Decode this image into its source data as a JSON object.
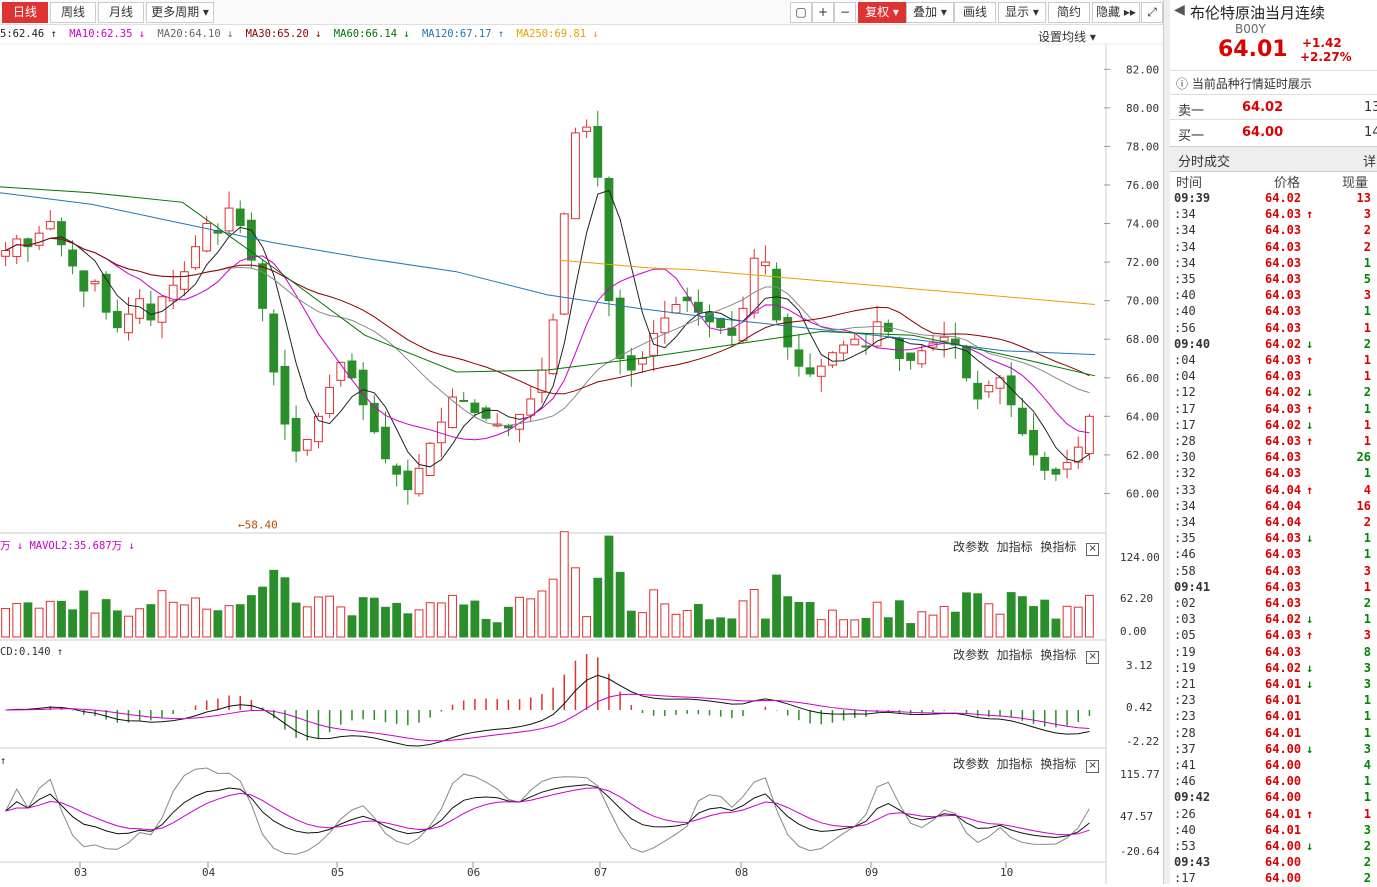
{
  "toolbar": {
    "periods": [
      "日线",
      "周线",
      "月线",
      "更多周期 ▾"
    ],
    "actions": [
      "复权 ▾",
      "叠加 ▾",
      "画线",
      "显示 ▾",
      "简约",
      "隐藏 ▸▸"
    ]
  },
  "ma_legend": [
    {
      "text": "5:62.46 ↑",
      "color": "#222222"
    },
    {
      "text": "MA10:62.35 ↓",
      "color": "#cc00cc"
    },
    {
      "text": "MA20:64.10 ↓",
      "color": "#666666"
    },
    {
      "text": "MA30:65.20 ↓",
      "color": "#8b0000"
    },
    {
      "text": "MA60:66.14 ↓",
      "color": "#007700"
    },
    {
      "text": "MA120:67.17 ↑",
      "color": "#1f77b4"
    },
    {
      "text": "MA250:69.81 ↓",
      "color": "#e6a100"
    }
  ],
  "ma_settings": "设置均线 ▾",
  "vol_header": "万 ↓ MAVOL2:35.687万 ↓",
  "macd_header": "CD:0.140 ↑",
  "kdj_header": "↑",
  "panel_actions": [
    "改参数",
    "加指标",
    "换指标"
  ],
  "close_glyph": "×",
  "chart_data": {
    "type": "candlestick",
    "x_ticks": [
      "03",
      "04",
      "05",
      "06",
      "07",
      "08",
      "09",
      "10"
    ],
    "price_y_ticks": [
      "82.00",
      "80.00",
      "78.00",
      "76.00",
      "74.00",
      "72.00",
      "70.00",
      "68.00",
      "66.00",
      "64.00",
      "62.00",
      "60.00"
    ],
    "price_low_label": "←58.40",
    "volume_y_ticks": [
      "124.00",
      "62.20",
      "0.00"
    ],
    "macd_y_ticks": [
      "3.12",
      "0.42",
      "-2.22"
    ],
    "kdj_y_ticks": [
      "115.77",
      "47.57",
      "-20.64"
    ],
    "ohlc_close_path": [
      72.6,
      73.2,
      72.8,
      73.5,
      74.1,
      72.9,
      71.8,
      70.5,
      71.0,
      69.4,
      68.6,
      69.3,
      70.1,
      69.0,
      70.2,
      70.8,
      71.5,
      72.8,
      74.0,
      73.5,
      74.8,
      73.9,
      72.1,
      69.6,
      66.3,
      63.6,
      62.2,
      62.8,
      64.0,
      65.5,
      66.8,
      66.0,
      64.6,
      63.2,
      61.8,
      61.0,
      60.2,
      61.3,
      62.6,
      63.7,
      65.0,
      64.8,
      64.2,
      63.9,
      63.6,
      63.4,
      64.1,
      64.9,
      66.4,
      69.0,
      74.5,
      78.7,
      79.0,
      76.4,
      70.0,
      67.0,
      66.4,
      67.0,
      68.3,
      69.1,
      69.8,
      70.0,
      69.4,
      68.9,
      68.6,
      68.2,
      69.6,
      72.2,
      72.0,
      69.0,
      67.6,
      66.6,
      66.2,
      66.6,
      67.3,
      67.7,
      68.0,
      67.6,
      68.9,
      68.4,
      67.0,
      66.9,
      67.4,
      67.8,
      68.1,
      67.7,
      66.0,
      64.9,
      65.6,
      66.0,
      64.6,
      63.1,
      62.0,
      61.2,
      61.0,
      61.6,
      62.4,
      64.0
    ],
    "ma_series": [
      {
        "name": "MA250",
        "color": "#e6a100",
        "values": [
          72.1,
          71.9,
          71.7,
          71.6,
          71.4,
          71.2,
          71.0,
          70.8,
          70.6,
          70.4,
          70.2,
          70.0,
          69.8
        ]
      },
      {
        "name": "MA120",
        "color": "#1f77b4",
        "values": [
          75.6,
          75.0,
          74.0,
          73.0,
          72.2,
          71.5,
          70.3,
          69.6,
          69.0,
          68.5,
          68.0,
          67.4,
          67.2
        ]
      },
      {
        "name": "MA60",
        "color": "#007700",
        "values": [
          75.9,
          75.6,
          75.1,
          71.7,
          68.2,
          66.3,
          66.4,
          67.0,
          67.7,
          68.4,
          68.2,
          67.2,
          66.1
        ]
      }
    ]
  },
  "quote": {
    "title": "布伦特原油当月连续",
    "code": "B00Y",
    "price": "64.01",
    "change": "+1.42",
    "change_pct": "+2.27%",
    "notice": "当前品种行情延时展示",
    "ask_label": "卖一",
    "ask_price": "64.02",
    "ask_vol": "13",
    "bid_label": "买一",
    "bid_price": "64.00",
    "bid_vol": "14",
    "ticks_title": "分时成交",
    "detail_btn": "详",
    "cols": [
      "时间",
      "价格",
      "现量"
    ]
  },
  "ticks": [
    {
      "t": "09:39",
      "p": "64.02",
      "a": "",
      "v": "13",
      "c": "up"
    },
    {
      "t": ":34",
      "p": "64.03",
      "a": "↑",
      "v": "3",
      "c": "up"
    },
    {
      "t": ":34",
      "p": "64.03",
      "a": "",
      "v": "2",
      "c": "up"
    },
    {
      "t": ":34",
      "p": "64.03",
      "a": "",
      "v": "2",
      "c": "up"
    },
    {
      "t": ":34",
      "p": "64.03",
      "a": "",
      "v": "1",
      "c": "dn"
    },
    {
      "t": ":35",
      "p": "64.03",
      "a": "",
      "v": "5",
      "c": "dn"
    },
    {
      "t": ":40",
      "p": "64.03",
      "a": "",
      "v": "3",
      "c": "up"
    },
    {
      "t": ":40",
      "p": "64.03",
      "a": "",
      "v": "1",
      "c": "dn"
    },
    {
      "t": ":56",
      "p": "64.03",
      "a": "",
      "v": "1",
      "c": "up"
    },
    {
      "t": "09:40",
      "p": "64.02",
      "a": "↓",
      "v": "2",
      "c": "dn"
    },
    {
      "t": ":04",
      "p": "64.03",
      "a": "↑",
      "v": "1",
      "c": "up"
    },
    {
      "t": ":04",
      "p": "64.03",
      "a": "",
      "v": "1",
      "c": "up"
    },
    {
      "t": ":12",
      "p": "64.02",
      "a": "↓",
      "v": "2",
      "c": "dn"
    },
    {
      "t": ":17",
      "p": "64.03",
      "a": "↑",
      "v": "1",
      "c": "dn"
    },
    {
      "t": ":17",
      "p": "64.02",
      "a": "↓",
      "v": "1",
      "c": "up"
    },
    {
      "t": ":28",
      "p": "64.03",
      "a": "↑",
      "v": "1",
      "c": "up"
    },
    {
      "t": ":30",
      "p": "64.03",
      "a": "",
      "v": "26",
      "c": "dn"
    },
    {
      "t": ":32",
      "p": "64.03",
      "a": "",
      "v": "1",
      "c": "dn"
    },
    {
      "t": ":33",
      "p": "64.04",
      "a": "↑",
      "v": "4",
      "c": "up"
    },
    {
      "t": ":34",
      "p": "64.04",
      "a": "",
      "v": "16",
      "c": "up"
    },
    {
      "t": ":34",
      "p": "64.04",
      "a": "",
      "v": "2",
      "c": "up"
    },
    {
      "t": ":35",
      "p": "64.03",
      "a": "↓",
      "v": "1",
      "c": "dn"
    },
    {
      "t": ":46",
      "p": "64.03",
      "a": "",
      "v": "1",
      "c": "dn"
    },
    {
      "t": ":58",
      "p": "64.03",
      "a": "",
      "v": "3",
      "c": "up"
    },
    {
      "t": "09:41",
      "p": "64.03",
      "a": "",
      "v": "1",
      "c": "up"
    },
    {
      "t": ":02",
      "p": "64.03",
      "a": "",
      "v": "2",
      "c": "dn"
    },
    {
      "t": ":03",
      "p": "64.02",
      "a": "↓",
      "v": "1",
      "c": "dn"
    },
    {
      "t": ":05",
      "p": "64.03",
      "a": "↑",
      "v": "3",
      "c": "up"
    },
    {
      "t": ":19",
      "p": "64.03",
      "a": "",
      "v": "8",
      "c": "dn"
    },
    {
      "t": ":19",
      "p": "64.02",
      "a": "↓",
      "v": "3",
      "c": "dn"
    },
    {
      "t": ":21",
      "p": "64.01",
      "a": "↓",
      "v": "3",
      "c": "dn"
    },
    {
      "t": ":23",
      "p": "64.01",
      "a": "",
      "v": "1",
      "c": "dn"
    },
    {
      "t": ":23",
      "p": "64.01",
      "a": "",
      "v": "1",
      "c": "dn"
    },
    {
      "t": ":28",
      "p": "64.01",
      "a": "",
      "v": "1",
      "c": "dn"
    },
    {
      "t": ":37",
      "p": "64.00",
      "a": "↓",
      "v": "3",
      "c": "dn"
    },
    {
      "t": ":41",
      "p": "64.00",
      "a": "",
      "v": "4",
      "c": "dn"
    },
    {
      "t": ":46",
      "p": "64.00",
      "a": "",
      "v": "1",
      "c": "dn"
    },
    {
      "t": "09:42",
      "p": "64.00",
      "a": "",
      "v": "1",
      "c": "dn"
    },
    {
      "t": ":26",
      "p": "64.01",
      "a": "↑",
      "v": "1",
      "c": "up"
    },
    {
      "t": ":40",
      "p": "64.01",
      "a": "",
      "v": "3",
      "c": "dn"
    },
    {
      "t": ":53",
      "p": "64.00",
      "a": "↓",
      "v": "2",
      "c": "dn"
    },
    {
      "t": "09:43",
      "p": "64.00",
      "a": "",
      "v": "2",
      "c": "dn"
    },
    {
      "t": ":17",
      "p": "64.00",
      "a": "",
      "v": "2",
      "c": "dn"
    }
  ]
}
